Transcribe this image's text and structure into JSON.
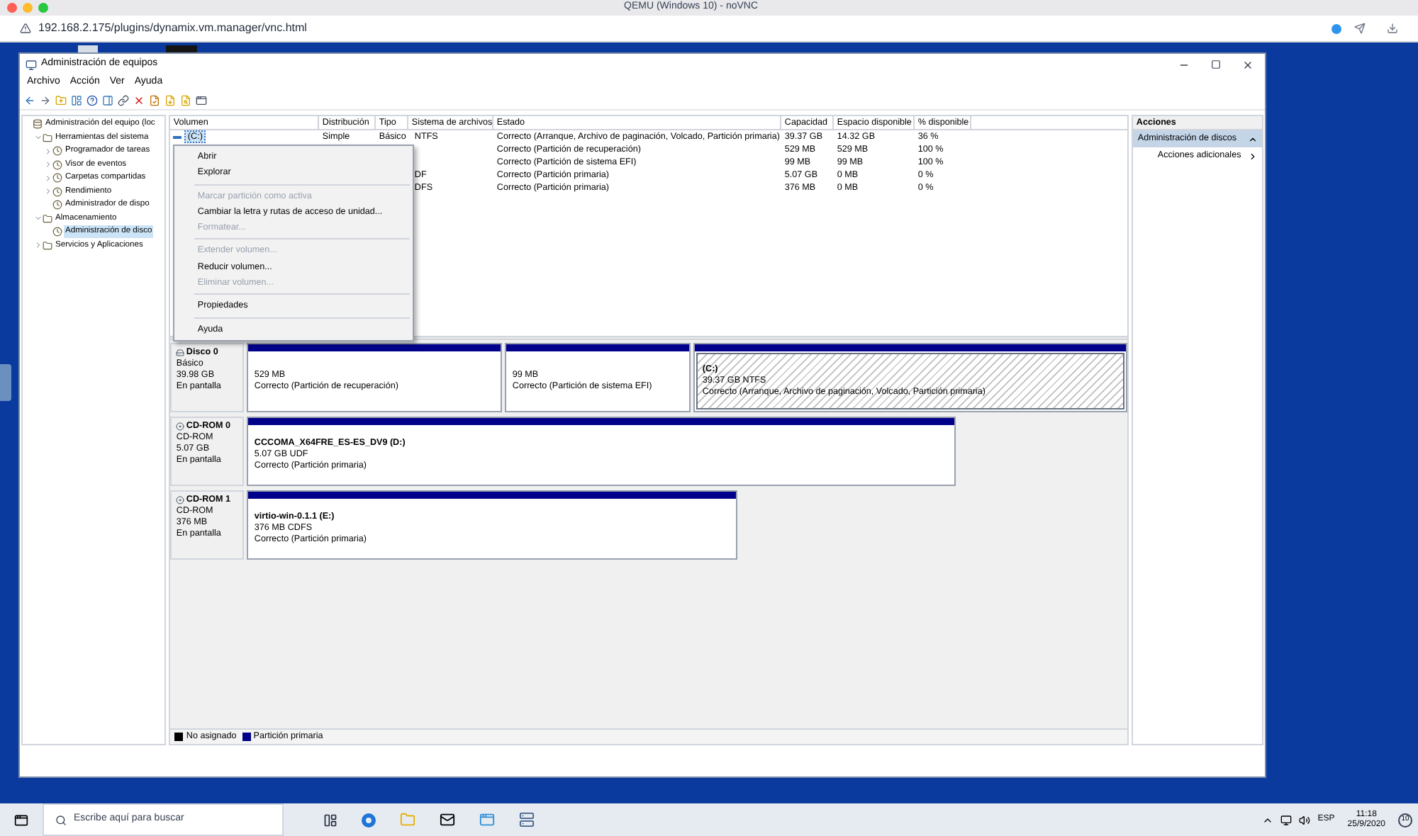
{
  "browser": {
    "title": "QEMU (Windows 10) - noVNC",
    "url": "192.168.2.175/plugins/dynamix.vm.manager/vnc.html"
  },
  "window": {
    "title": "Administración de equipos",
    "menu": [
      "Archivo",
      "Acción",
      "Ver",
      "Ayuda"
    ]
  },
  "tree": [
    {
      "label": "Administración del equipo (loc",
      "selected": false,
      "children": [
        {
          "label": "Herramientas del sistema",
          "expanded": true,
          "selected": false,
          "children": [
            {
              "label": "Programador de tareas",
              "expanded": false,
              "selected": false
            },
            {
              "label": "Visor de eventos",
              "expanded": false,
              "selected": false
            },
            {
              "label": "Carpetas compartidas",
              "expanded": false,
              "selected": false
            },
            {
              "label": "Rendimiento",
              "expanded": false,
              "selected": false
            },
            {
              "label": "Administrador de dispo",
              "selected": false
            }
          ]
        },
        {
          "label": "Almacenamiento",
          "expanded": true,
          "selected": false,
          "children": [
            {
              "label": "Administración de disco",
              "selected": true
            }
          ]
        },
        {
          "label": "Servicios y Aplicaciones",
          "expanded": false,
          "selected": false
        }
      ]
    }
  ],
  "volumes": {
    "columns": [
      "Volumen",
      "Distribución",
      "Tipo",
      "Sistema de archivos",
      "Estado",
      "Capacidad",
      "Espacio disponible",
      "% disponible"
    ],
    "rows": [
      {
        "volume": "(C:)",
        "layout": "Simple",
        "type": "Básico",
        "fs": "NTFS",
        "status": "Correcto (Arranque, Archivo de paginación, Volcado, Partición primaria)",
        "capacity": "39.37 GB",
        "free": "14.32 GB",
        "pct": "36 %",
        "selected": true
      },
      {
        "status": "Correcto (Partición de recuperación)",
        "capacity": "529 MB",
        "free": "529 MB",
        "pct": "100 %"
      },
      {
        "status": "Correcto (Partición de sistema EFI)",
        "capacity": "99 MB",
        "free": "99 MB",
        "pct": "100 %"
      },
      {
        "fs": "DF",
        "status": "Correcto (Partición primaria)",
        "capacity": "5.07 GB",
        "free": "0 MB",
        "pct": "0 %"
      },
      {
        "fs": "DFS",
        "status": "Correcto (Partición primaria)",
        "capacity": "376 MB",
        "free": "0 MB",
        "pct": "0 %"
      }
    ]
  },
  "context_menu": [
    {
      "kind": "item",
      "label": "Abrir",
      "disabled": false
    },
    {
      "kind": "item",
      "label": "Explorar",
      "disabled": false
    },
    {
      "kind": "separator"
    },
    {
      "kind": "item",
      "label": "Marcar partición como activa",
      "disabled": true
    },
    {
      "kind": "item",
      "label": "Cambiar la letra y rutas de acceso de unidad...",
      "disabled": false
    },
    {
      "kind": "item",
      "label": "Formatear...",
      "disabled": true
    },
    {
      "kind": "separator"
    },
    {
      "kind": "item",
      "label": "Extender volumen...",
      "disabled": true
    },
    {
      "kind": "item",
      "label": "Reducir volumen...",
      "disabled": false
    },
    {
      "kind": "item",
      "label": "Eliminar volumen...",
      "disabled": true
    },
    {
      "kind": "separator"
    },
    {
      "kind": "item",
      "label": "Propiedades",
      "disabled": false
    },
    {
      "kind": "separator"
    },
    {
      "kind": "item",
      "label": "Ayuda",
      "disabled": false
    }
  ],
  "disks": [
    {
      "kind": "disk",
      "name": "Disco 0",
      "type": "Básico",
      "size": "39.98 GB",
      "state": "En pantalla",
      "partitions": [
        {
          "size": "529 MB",
          "status": "Correcto (Partición de recuperación)",
          "selected": false
        },
        {
          "size": "99 MB",
          "status": "Correcto (Partición de sistema EFI)",
          "selected": false
        },
        {
          "label": "(C:)",
          "size": "39.37 GB NTFS",
          "status": "Correcto (Arranque, Archivo de paginación, Volcado, Partición primaria)",
          "selected": true
        }
      ]
    },
    {
      "kind": "cdrom",
      "name": "CD-ROM 0",
      "type": "CD-ROM",
      "size": "5.07 GB",
      "state": "En pantalla",
      "partitions": [
        {
          "label": "CCCOMA_X64FRE_ES-ES_DV9  (D:)",
          "size": "5.07 GB UDF",
          "status": "Correcto (Partición primaria)",
          "selected": false
        }
      ]
    },
    {
      "kind": "cdrom",
      "name": "CD-ROM 1",
      "type": "CD-ROM",
      "size": "376 MB",
      "state": "En pantalla",
      "partitions": [
        {
          "label": "virtio-win-0.1.1  (E:)",
          "size": "376 MB CDFS",
          "status": "Correcto (Partición primaria)",
          "selected": false
        }
      ]
    }
  ],
  "legend": [
    {
      "label": "No asignado",
      "color": "#000000"
    },
    {
      "label": "Partición primaria",
      "color": "#00008b"
    }
  ],
  "actions": {
    "header": "Acciones",
    "items": [
      {
        "label": "Administración de discos",
        "kind": "group",
        "selected": true
      },
      {
        "label": "Acciones adicionales",
        "kind": "submenu",
        "selected": false
      }
    ]
  },
  "taskbar": {
    "search_placeholder": "Escribe aquí para buscar",
    "language": "ESP",
    "time": "11:18",
    "date": "25/9/2020",
    "notifications": "10"
  }
}
